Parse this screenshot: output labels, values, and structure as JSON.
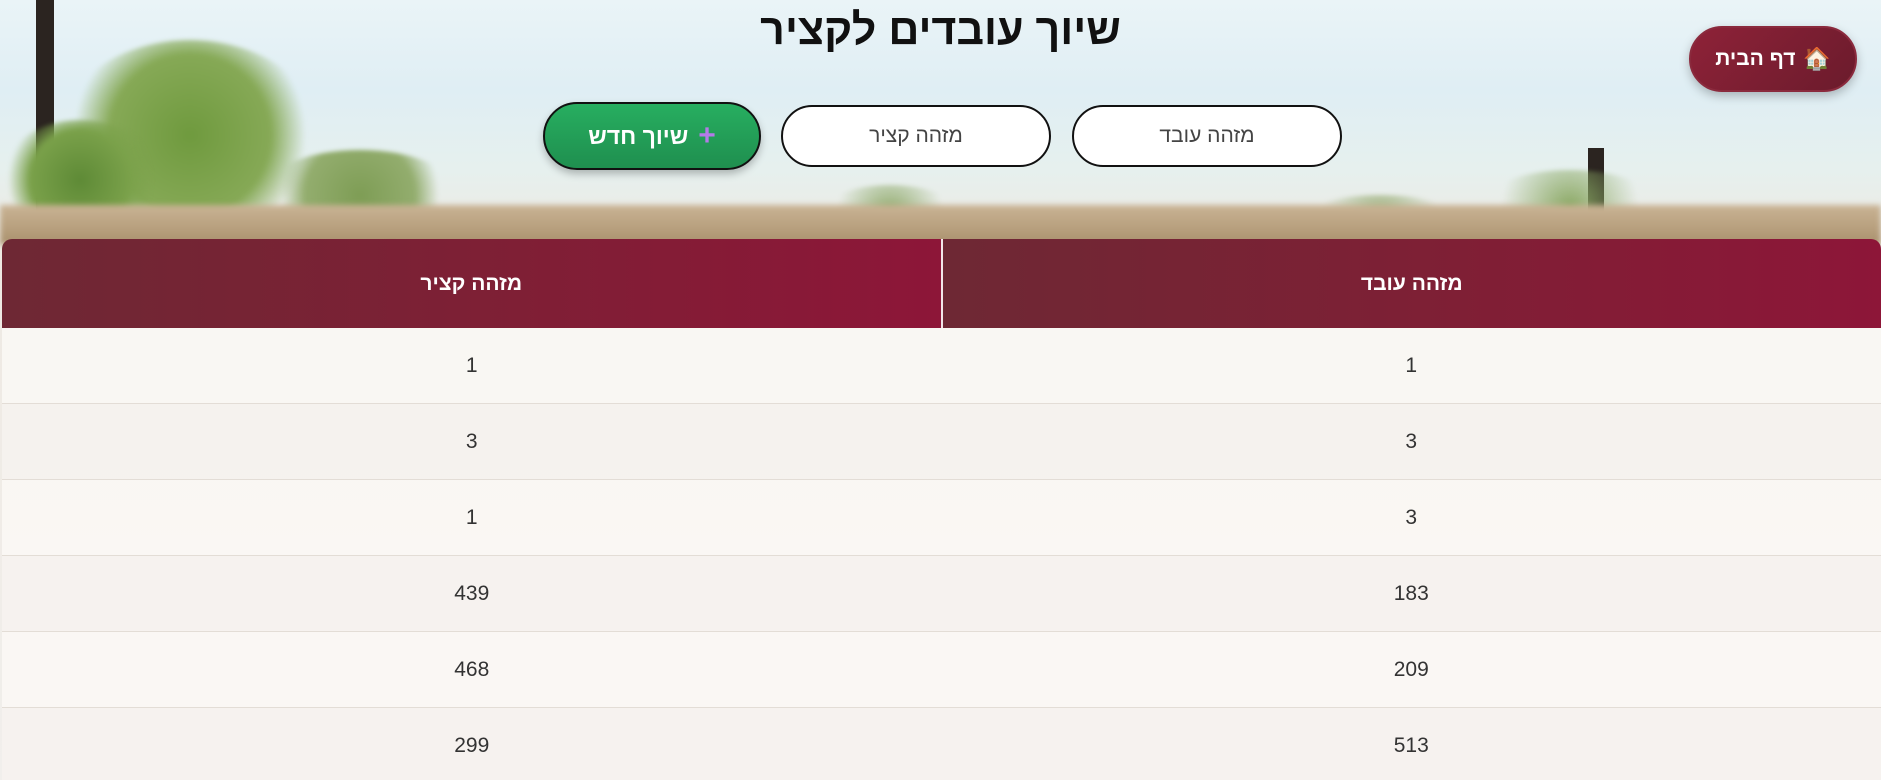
{
  "page_title": "שיוך עובדים לקציר",
  "home_button": {
    "icon": "house-icon",
    "label": "דף הבית"
  },
  "filters": {
    "worker_id_placeholder": "מזהה עובד",
    "worker_id_value": "",
    "harvest_id_placeholder": "מזהה קציר",
    "harvest_id_value": ""
  },
  "new_button": {
    "icon": "plus-icon",
    "label": "שיוך חדש"
  },
  "table": {
    "columns": [
      "מזהה עובד",
      "מזהה קציר"
    ],
    "rows": [
      [
        "1",
        "1"
      ],
      [
        "3",
        "3"
      ],
      [
        "3",
        "1"
      ],
      [
        "183",
        "439"
      ],
      [
        "209",
        "468"
      ],
      [
        "513",
        "299"
      ]
    ]
  },
  "colors": {
    "header_bg": "#7f1f35",
    "home_button_bg": "#8e2238",
    "new_button_bg": "#27ae60"
  }
}
